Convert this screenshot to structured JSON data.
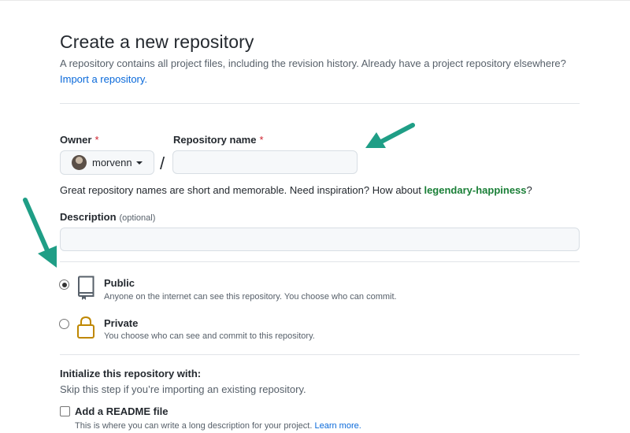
{
  "page": {
    "title": "Create a new repository",
    "subtitle": "A repository contains all project files, including the revision history. Already have a project repository elsewhere?",
    "import_link": "Import a repository."
  },
  "owner": {
    "label": "Owner",
    "required_mark": "*",
    "value": "morvenn"
  },
  "separator": "/",
  "repo_name": {
    "label": "Repository name",
    "required_mark": "*",
    "value": ""
  },
  "name_hint": {
    "text": "Great repository names are short and memorable. Need inspiration? How about ",
    "suggestion": "legendary-happiness",
    "suffix": "?"
  },
  "description": {
    "label": "Description",
    "optional_label": "(optional)",
    "value": ""
  },
  "visibility": {
    "selected": "public",
    "options": [
      {
        "title": "Public",
        "desc": "Anyone on the internet can see this repository. You choose who can commit.",
        "icon": "repo-icon"
      },
      {
        "title": "Private",
        "desc": "You choose who can see and commit to this repository.",
        "icon": "lock-icon"
      }
    ]
  },
  "initialize": {
    "title": "Initialize this repository with:",
    "subtitle": "Skip this step if you’re importing an existing repository.",
    "readme": {
      "label": "Add a README file",
      "checked": false,
      "desc": "This is where you can write a long description for your project. ",
      "link": "Learn more."
    }
  },
  "colors": {
    "link": "#0969da",
    "suggestion": "#1a7f37",
    "required": "#cf222e",
    "arrow": "#1f9e86",
    "lock": "#bf8700"
  }
}
